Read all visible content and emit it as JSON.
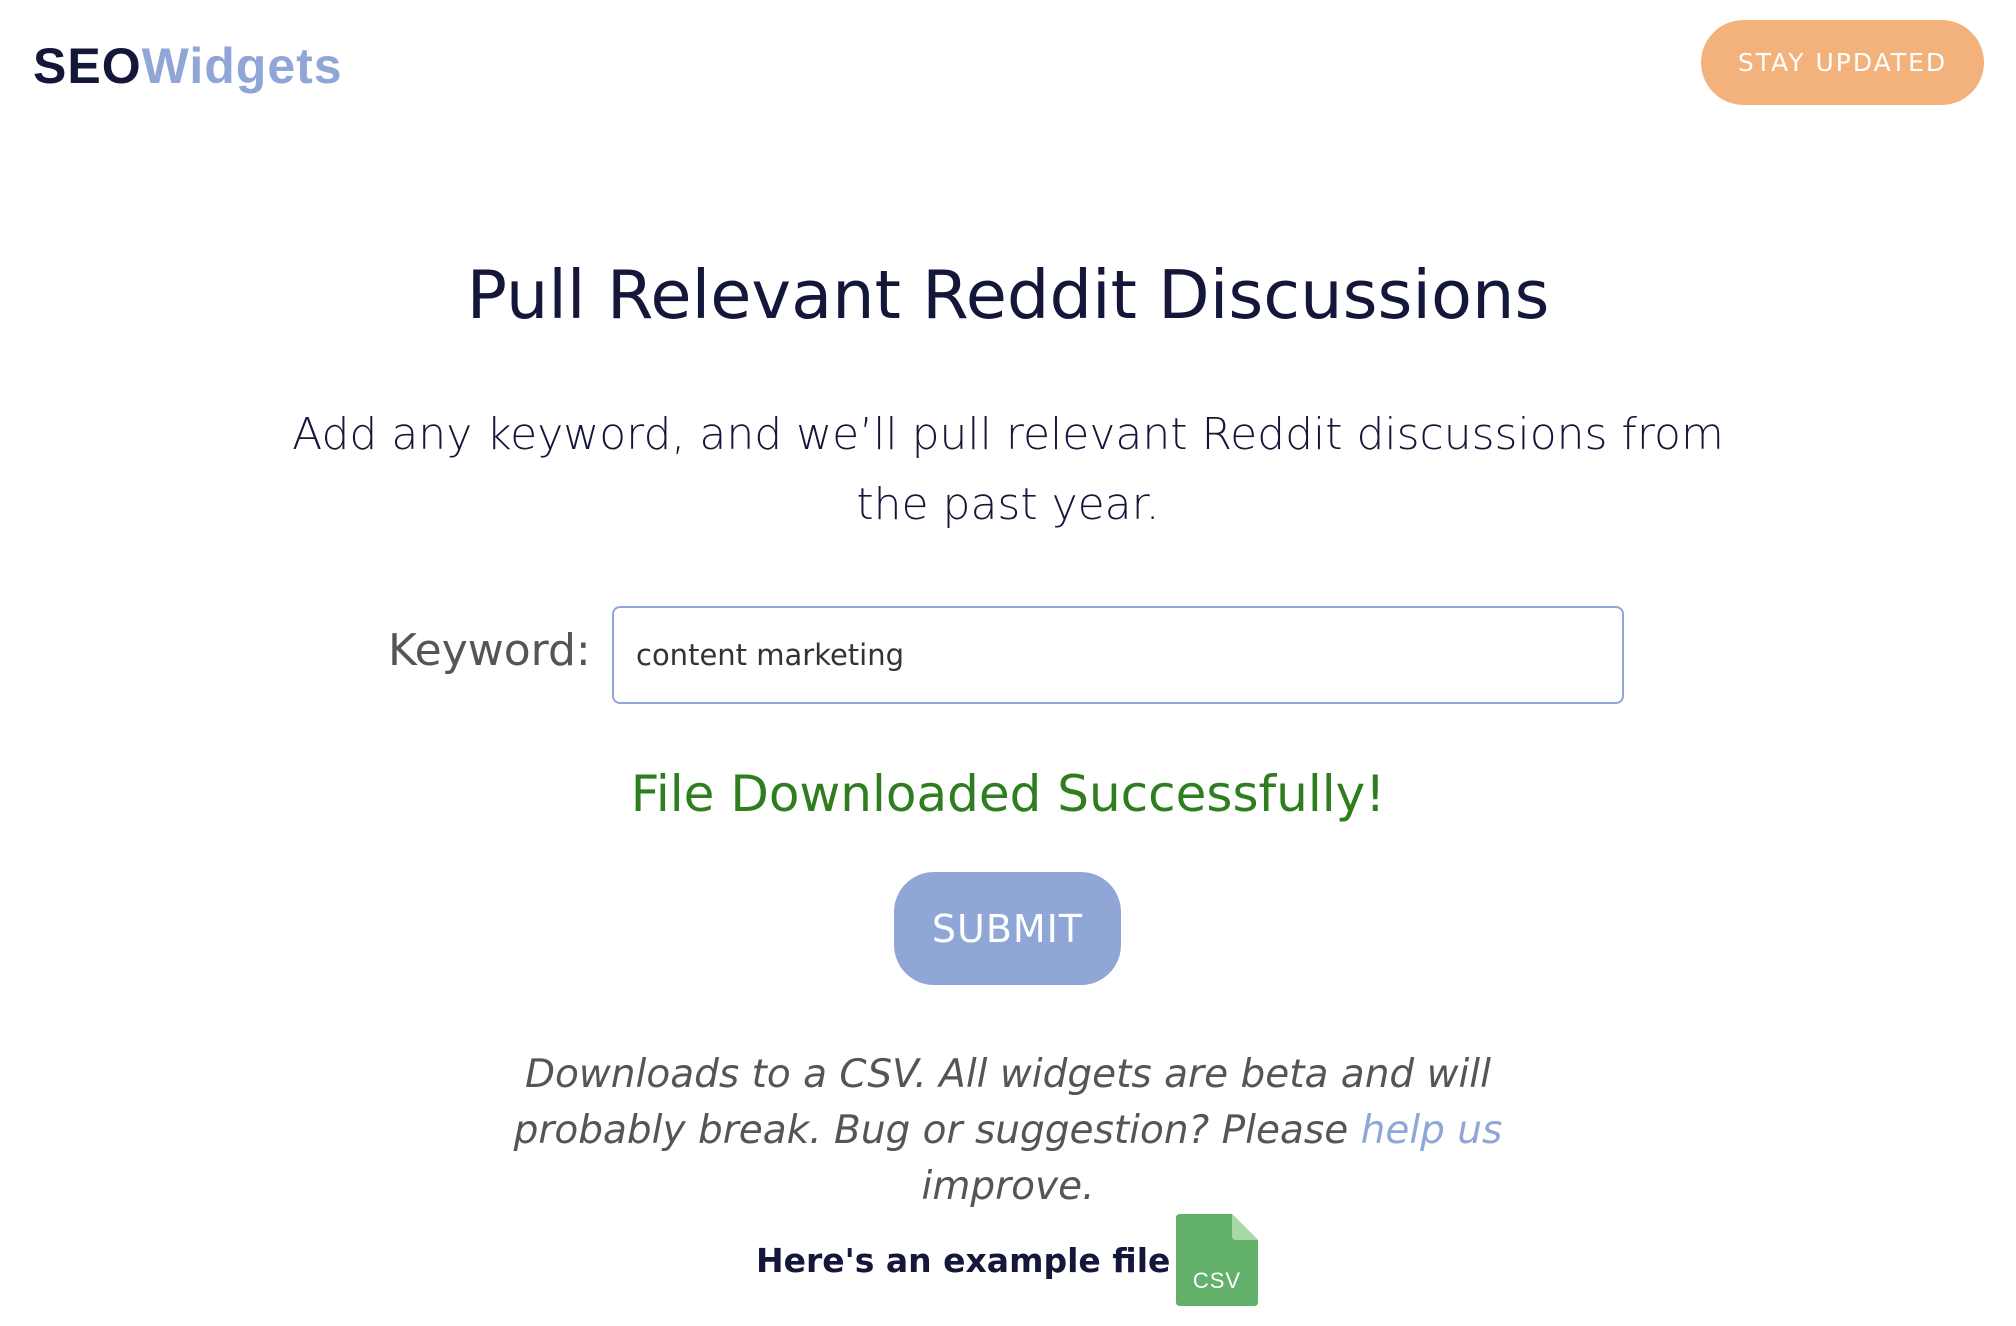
{
  "brand": {
    "logo_part1": "SEO",
    "logo_part2": "Widgets",
    "primary_color": "#14163a",
    "accent_color": "#8fa6d6"
  },
  "header": {
    "stay_updated_label": "STAY UPDATED",
    "stay_updated_color": "#f3b27c"
  },
  "main": {
    "title": "Pull Relevant Reddit Discussions",
    "subtitle": "Add any keyword, and we’ll pull relevant Reddit discussions from the past year.",
    "keyword_label": "Keyword:",
    "keyword_value": "content marketing",
    "success_message": "File Downloaded Successfully!",
    "success_color": "#2e7d1f",
    "submit_label": "SUBMIT"
  },
  "footer_note": {
    "text_before": "Downloads to a CSV. All widgets are beta and will probably break. Bug or suggestion? Please ",
    "link_text": "help us",
    "text_after": " improve."
  },
  "example": {
    "label": "Here's an example file →",
    "file_icon": "csv-file-icon",
    "file_icon_text": "CSV",
    "file_icon_color": "#62b06a"
  }
}
